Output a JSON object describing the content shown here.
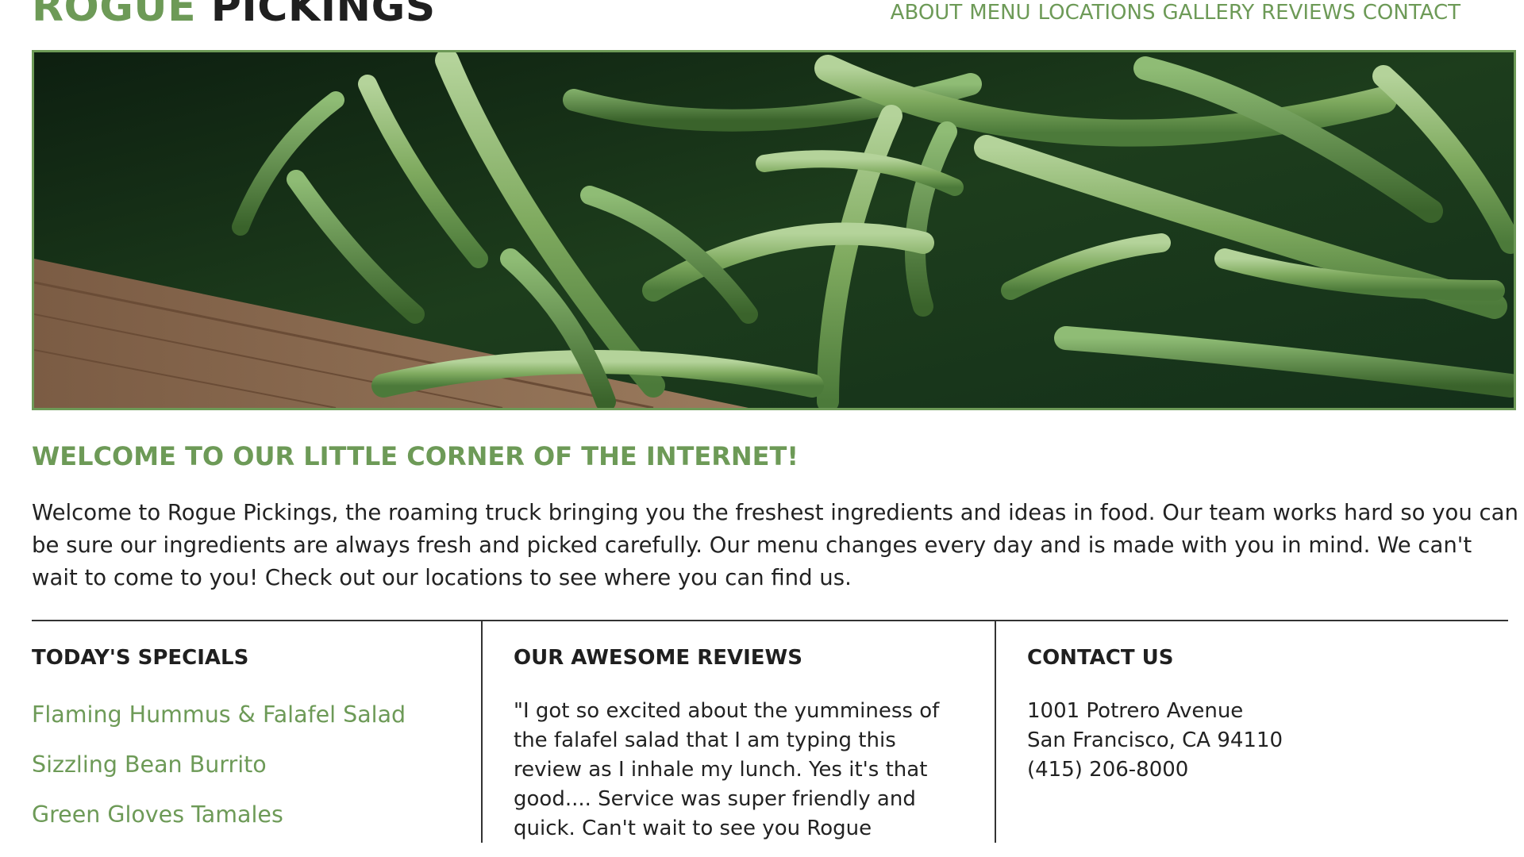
{
  "header": {
    "logo_part1": "ROGUE",
    "logo_part2": "PICKINGS",
    "nav": [
      "ABOUT",
      "MENU",
      "LOCATIONS",
      "GALLERY",
      "REVIEWS",
      "CONTACT"
    ]
  },
  "hero": {
    "image_icon": "green-beans-photo"
  },
  "welcome": {
    "title": "WELCOME TO OUR LITTLE CORNER OF THE INTERNET!",
    "text": "Welcome to Rogue Pickings, the roaming truck bringing you the freshest ingredients and ideas in food. Our team works hard so you can be sure our ingredients are always fresh and picked carefully. Our menu changes every day and is made with you in mind. We can't wait to come to you! Check out our locations to see where you can find us."
  },
  "specials": {
    "heading": "TODAY'S SPECIALS",
    "items": [
      "Flaming Hummus & Falafel Salad",
      "Sizzling Bean Burrito",
      "Green Gloves Tamales"
    ]
  },
  "reviews": {
    "heading": "OUR AWESOME REVIEWS",
    "text": "\"I got so excited about the yumminess of the falafel salad that I am typing this review as I inhale my lunch. Yes it's that good.... Service was super friendly and quick. Can't wait to see you Rogue"
  },
  "contact": {
    "heading": "CONTACT US",
    "address_line1": "1001 Potrero Avenue",
    "address_line2": "San Francisco, CA 94110",
    "phone": "(415) 206-8000"
  },
  "colors": {
    "accent": "#6d9a57",
    "text": "#222222",
    "heading": "#1f1f1f"
  }
}
